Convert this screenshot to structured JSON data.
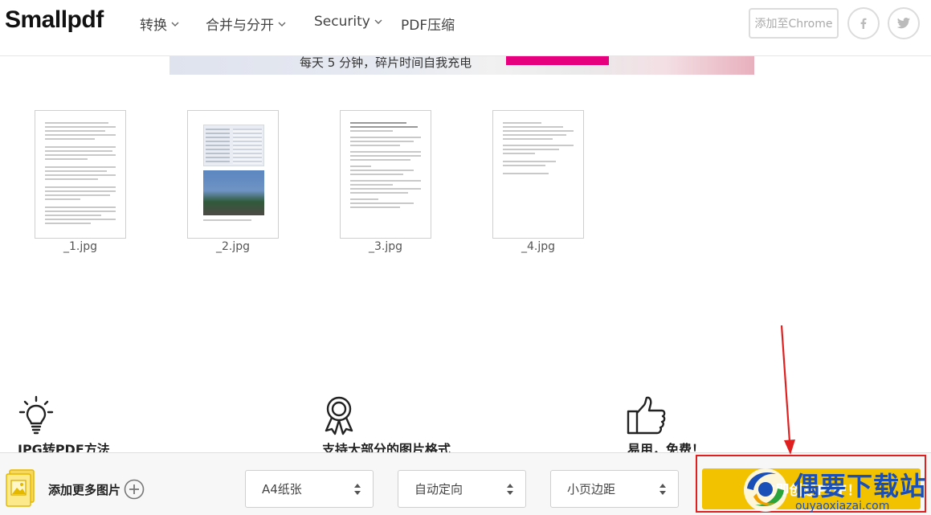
{
  "header": {
    "logo": "Smallpdf",
    "nav": [
      {
        "label": "转换"
      },
      {
        "label": "合并与分开"
      },
      {
        "label": "Security"
      },
      {
        "label": "PDF压缩"
      }
    ],
    "chrome_button": "添加至Chrome",
    "social": [
      "facebook-icon",
      "twitter-icon"
    ]
  },
  "banner": {
    "text": "每天 5 分钟，碎片时间自我充电"
  },
  "thumbnails": [
    {
      "name": "_1.jpg"
    },
    {
      "name": "_2.jpg"
    },
    {
      "name": "_3.jpg"
    },
    {
      "name": "_4.jpg"
    }
  ],
  "features": [
    {
      "icon": "lightbulb-icon",
      "title": "JPG转PDF方法"
    },
    {
      "icon": "ribbon-icon",
      "title": "支持大部分的图片格式"
    },
    {
      "icon": "thumbs-up-icon",
      "title": "易用，免费！"
    }
  ],
  "bottom": {
    "add_more": "添加更多图片",
    "paper_size": "A4纸张",
    "orientation": "自动定向",
    "margin": "小页边距",
    "convert_button": "立即创建PDF！"
  },
  "watermark": {
    "title": "偶要下载站",
    "url": "ouyaoxiazai.com"
  },
  "colors": {
    "accent_yellow": "#f2c200",
    "highlight_red": "#e02020",
    "watermark_blue": "#1a4fb8"
  }
}
